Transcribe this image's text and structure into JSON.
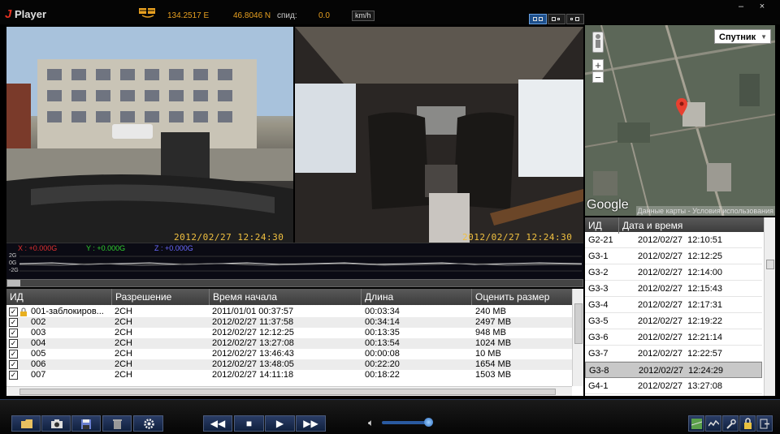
{
  "titlebar": {
    "app_name": "Player",
    "app_initial": "J",
    "longitude": "134.2517 E",
    "latitude": "46.8046 N",
    "speed_label": "спид:",
    "speed_value": "0.0",
    "speed_unit": "km/h",
    "window_controls": [
      "–",
      "×"
    ]
  },
  "video": {
    "left_timestamp": "2012/02/27  12:24:30",
    "right_timestamp": "2012/02/27  12:24:30"
  },
  "map": {
    "type_select": "Спутник",
    "zoom_in": "+",
    "zoom_out": "−",
    "google": "Google",
    "credit": "Данные карты - Условия использования"
  },
  "gsensor": {
    "x_label": "X : +0.000G",
    "y_label": "Y : +0.000G",
    "z_label": "Z : +0.000G",
    "ticks": [
      "2G",
      "0G",
      "-2G"
    ],
    "colors": {
      "x": "#e03030",
      "y": "#30d030",
      "z": "#6a6aff"
    }
  },
  "files": {
    "columns": [
      "ИД",
      "Разрешение",
      "Время начала",
      "Длина",
      "Оценить размер"
    ],
    "rows": [
      {
        "id": "001-заблокиров...",
        "res": "2CH",
        "start": "2011/01/01 00:37:57",
        "len": "00:03:34",
        "size": "240 MB",
        "locked": true
      },
      {
        "id": "002",
        "res": "2CH",
        "start": "2012/02/27 11:37:58",
        "len": "00:34:14",
        "size": "2497 MB",
        "locked": false
      },
      {
        "id": "003",
        "res": "2CH",
        "start": "2012/02/27 12:12:25",
        "len": "00:13:35",
        "size": "948 MB",
        "locked": false
      },
      {
        "id": "004",
        "res": "2CH",
        "start": "2012/02/27 13:27:08",
        "len": "00:13:54",
        "size": "1024 MB",
        "locked": false
      },
      {
        "id": "005",
        "res": "2CH",
        "start": "2012/02/27 13:46:43",
        "len": "00:00:08",
        "size": "10 MB",
        "locked": false
      },
      {
        "id": "006",
        "res": "2CH",
        "start": "2012/02/27 13:48:05",
        "len": "00:22:20",
        "size": "1654 MB",
        "locked": false
      },
      {
        "id": "007",
        "res": "2CH",
        "start": "2012/02/27 14:11:18",
        "len": "00:18:22",
        "size": "1503 MB",
        "locked": false
      }
    ]
  },
  "events": {
    "columns": [
      "ИД",
      "Дата и время"
    ],
    "selected": "G3-8",
    "rows": [
      {
        "id": "G2-21",
        "time": "2012/02/27  12:10:51"
      },
      {
        "id": "G3-1",
        "time": "2012/02/27  12:12:25"
      },
      {
        "id": "G3-2",
        "time": "2012/02/27  12:14:00"
      },
      {
        "id": "G3-3",
        "time": "2012/02/27  12:15:43"
      },
      {
        "id": "G3-4",
        "time": "2012/02/27  12:17:31"
      },
      {
        "id": "G3-5",
        "time": "2012/02/27  12:19:22"
      },
      {
        "id": "G3-6",
        "time": "2012/02/27  12:21:14"
      },
      {
        "id": "G3-7",
        "time": "2012/02/27  12:22:57"
      },
      {
        "id": "G3-8",
        "time": "2012/02/27  12:24:29"
      },
      {
        "id": "G4-1",
        "time": "2012/02/27  13:27:08"
      }
    ]
  },
  "controls": {
    "left_icons": [
      "folder-icon",
      "camera-icon",
      "save-icon",
      "trash-icon",
      "gear-icon"
    ],
    "playback": [
      "◀◀",
      "■",
      "▶",
      "▶▶"
    ],
    "volume_level": 0.85,
    "right_icons": [
      "map-icon",
      "graph-icon",
      "wrench-icon",
      "lock-icon",
      "exit-icon"
    ]
  },
  "accent": "#1d4f8c"
}
